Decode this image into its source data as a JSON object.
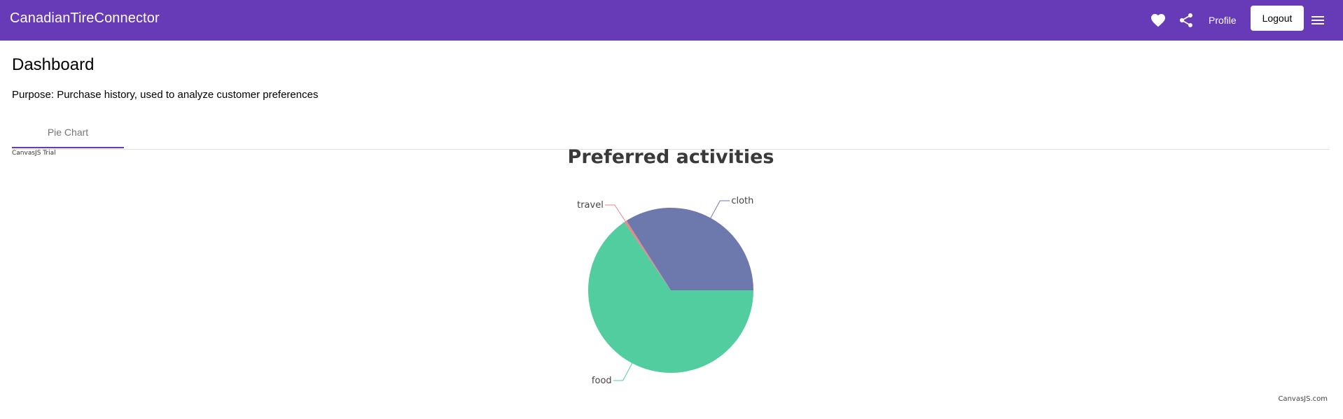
{
  "app": {
    "title": "CanadianTireConnector"
  },
  "toolbar": {
    "favorite_icon": "heart-icon",
    "share_icon": "share-icon",
    "profile_label": "Profile",
    "logout_label": "Logout",
    "menu_icon": "menu-icon"
  },
  "page": {
    "title": "Dashboard",
    "purpose": "Purpose: Purchase history, used to analyze customer preferences"
  },
  "tabs": [
    {
      "label": "Pie Chart",
      "active": true
    }
  ],
  "chart_watermark": "CanvasJS Trial",
  "chart_credit": "CanvasJS.com",
  "colors": {
    "primary": "#673ab7",
    "food": "#52cd9f",
    "travel": "#e8878a",
    "cloth": "#6d78ad"
  },
  "chart_data": {
    "type": "pie",
    "title": "Preferred activities",
    "slices": [
      {
        "label": "food",
        "value": 65.5
      },
      {
        "label": "travel",
        "value": 0.5
      },
      {
        "label": "cloth",
        "value": 34
      }
    ]
  }
}
